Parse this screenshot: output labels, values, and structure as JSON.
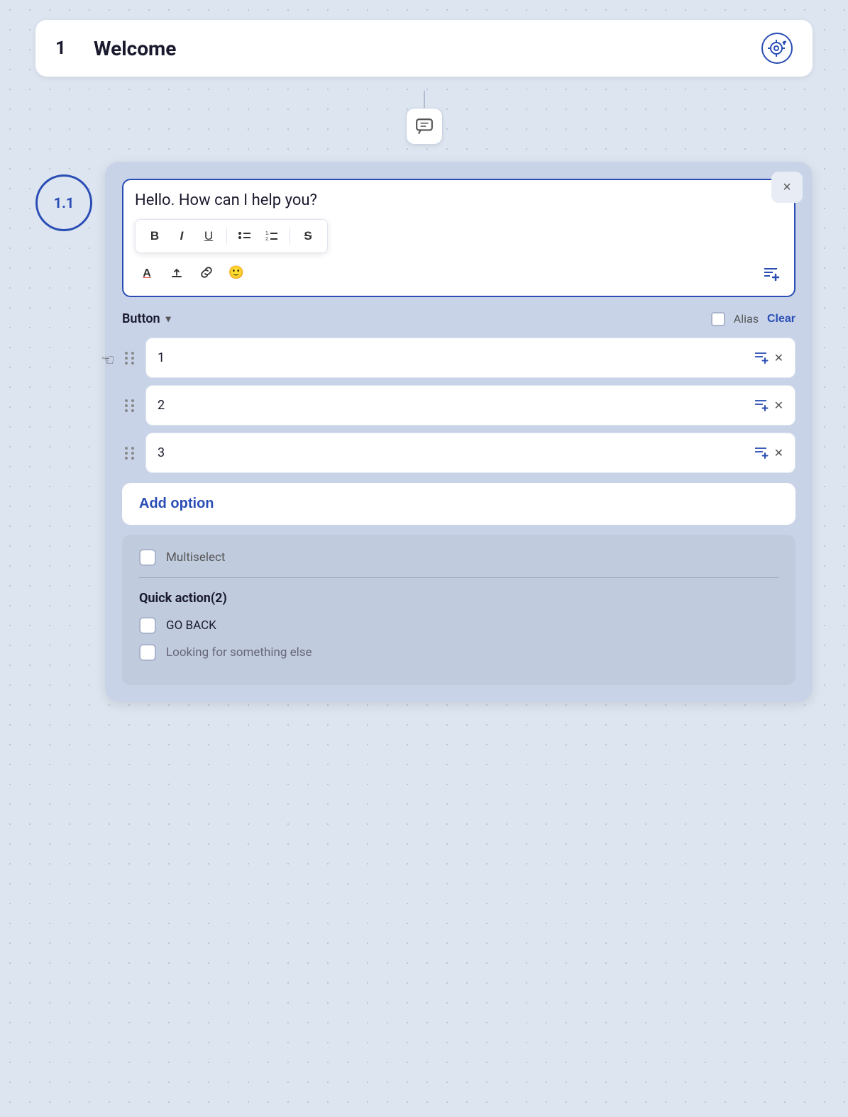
{
  "page": {
    "background_color": "#dde5f0"
  },
  "step_header": {
    "step_number": "1",
    "title": "Welcome",
    "icon_label": "add-target-icon"
  },
  "node_label": "1.1",
  "editor": {
    "text": "Hello. How can I help you?",
    "toolbar1": {
      "bold": "B",
      "italic": "I",
      "underline": "U",
      "bullet_list": "☰",
      "numbered_list": "≡",
      "strikethrough": "S"
    },
    "toolbar2": {
      "font_color": "A",
      "upload": "↑",
      "link": "🔗",
      "emoji": "🙂",
      "add_row": "≡+"
    }
  },
  "button_section": {
    "dropdown_label": "Button",
    "alias_label": "Alias",
    "clear_label": "Clear"
  },
  "options": [
    {
      "id": 1,
      "value": "1"
    },
    {
      "id": 2,
      "value": "2"
    },
    {
      "id": 3,
      "value": "3"
    }
  ],
  "add_option_label": "Add option",
  "multiselect": {
    "label": "Multiselect"
  },
  "quick_action": {
    "title": "Quick action(2)",
    "items": [
      {
        "label": "GO BACK"
      },
      {
        "label": "Looking for something else"
      }
    ]
  },
  "close_label": "×"
}
